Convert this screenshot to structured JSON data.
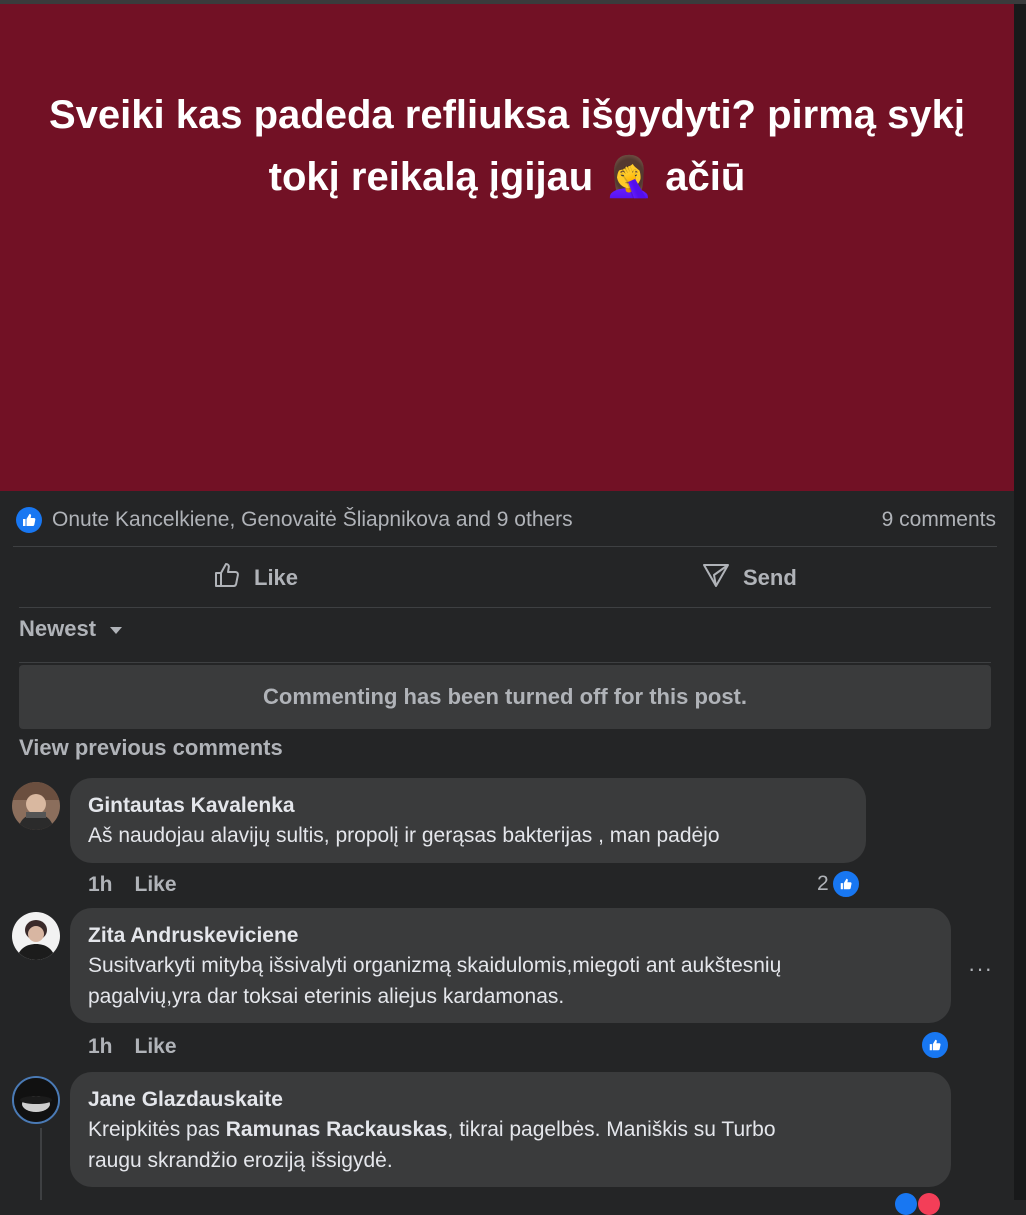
{
  "post": {
    "text": "Sveiki kas padeda refliuksa išgydyti? pirmą sykį tokį reikalą įgijau 🤦‍♀️ ačiū",
    "background_color": "#721125"
  },
  "reactions": {
    "icon": "like-icon",
    "reactors": "Onute Kancelkiene, Genovaitė Šliapnikova and 9 others",
    "comments_count": "9 comments"
  },
  "actions": {
    "like_label": "Like",
    "send_label": "Send"
  },
  "sort": {
    "label": "Newest"
  },
  "notice": "Commenting has been turned off for this post.",
  "view_previous": "View previous comments",
  "comments": [
    {
      "author": "Gintautas Kavalenka",
      "text": "Aš naudojau alavijų sultis, propolį ir gerąsas bakterijas , man padėjo",
      "time": "1h",
      "like_label": "Like",
      "reactions": "2"
    },
    {
      "author": "Zita Andruskeviciene",
      "text_line1": "Susitvarkyti mitybą išsivalyti organizmą skaidulomis,miegoti ant aukštesnių",
      "text_line2": "pagalvių,yra dar toksai eterinis aliejus kardamonas.",
      "time": "1h",
      "like_label": "Like",
      "more": "···"
    },
    {
      "author": "Jane Glazdauskaite",
      "text_prefix": "Kreipkitės pas ",
      "mention": "Ramunas Rackauskas",
      "text_suffix": ", tikrai pagelbės. Maniškis su Turbo",
      "text_line2": "raugu skrandžio eroziją išsigydė."
    }
  ],
  "colors": {
    "background": "#242526",
    "bubble": "#3a3b3c",
    "text_primary": "#e4e6eb",
    "text_secondary": "#b0b3b8",
    "accent": "#1877f2"
  }
}
